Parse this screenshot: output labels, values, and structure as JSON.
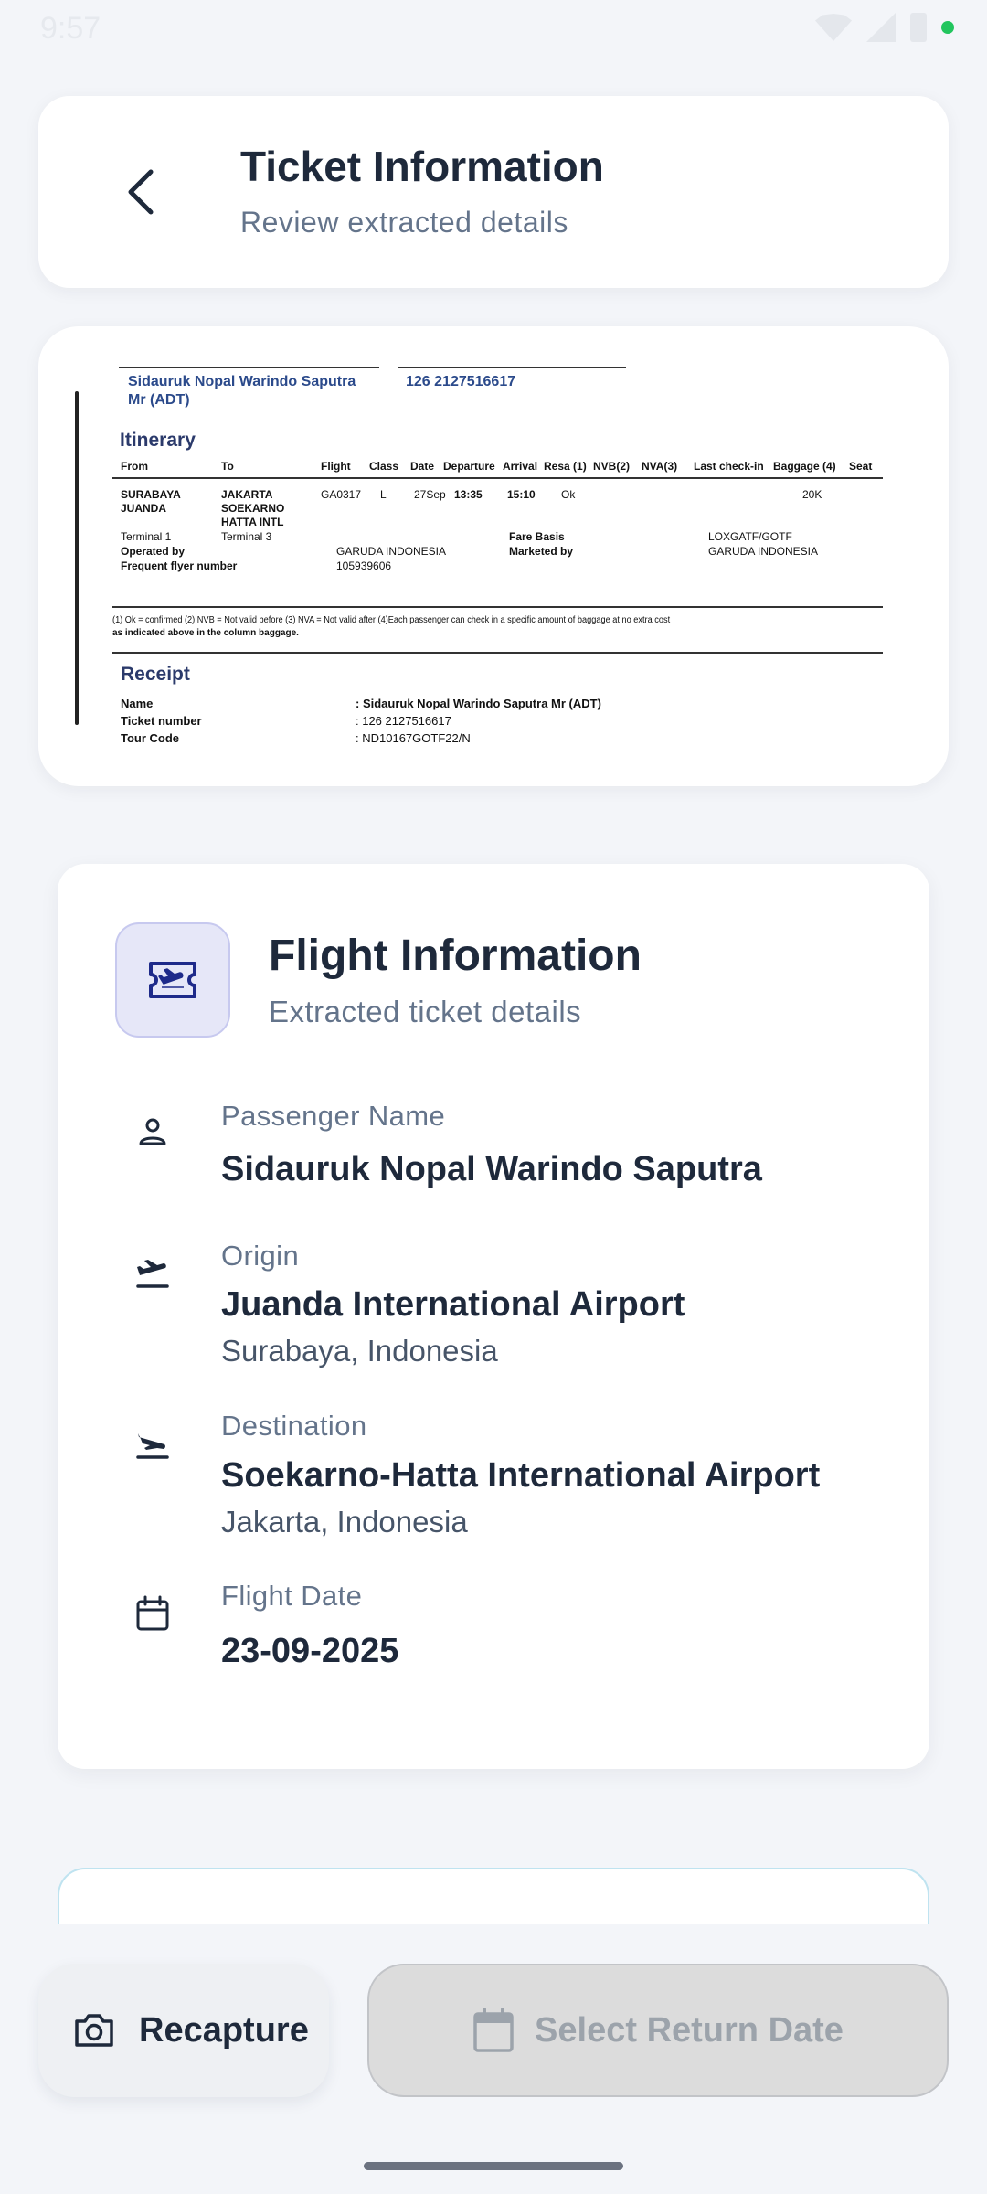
{
  "status_bar": {
    "time": "9:57"
  },
  "header": {
    "title": "Ticket Information",
    "subtitle": "Review extracted details"
  },
  "ticket_image": {
    "passenger_name_line1": "Sidauruk Nopal Warindo Saputra",
    "passenger_name_line2": "Mr (ADT)",
    "ticket_number_top": "126 2127516617",
    "itinerary_heading": "Itinerary",
    "columns": [
      "From",
      "To",
      "Flight",
      "Class",
      "Date",
      "Departure",
      "Arrival",
      "Resa (1)",
      "NVB(2)",
      "NVA(3)",
      "Last check-in",
      "Baggage (4)",
      "Seat"
    ],
    "from_1": "SURABAYA",
    "from_2": "JUANDA",
    "to_1": "JAKARTA",
    "to_2": "SOEKARNO",
    "to_3": "HATTA INTL",
    "flight": "GA0317",
    "class": "L",
    "date": "27Sep",
    "departure": "13:35",
    "arrival": "15:10",
    "resa": "Ok",
    "baggage": "20K",
    "terminal_from": "Terminal 1",
    "terminal_to": "Terminal 3",
    "fare_basis_label": "Fare Basis",
    "fare_basis": "LOXGATF/GOTF",
    "operated_by_label": "Operated by",
    "operated_by": "GARUDA INDONESIA",
    "marketed_by_label": "Marketed by",
    "marketed_by": "GARUDA INDONESIA",
    "ffn_label": "Frequent flyer number",
    "ffn": "105939606",
    "notes_line1": "(1) Ok = confirmed (2) NVB = Not valid before (3) NVA = Not valid after (4)Each passenger can check in a specific amount of baggage at no extra cost",
    "notes_line2": "as indicated above in the column baggage.",
    "receipt_heading": "Receipt",
    "name_label": "Name",
    "name_value": ": Sidauruk Nopal Warindo Saputra Mr (ADT)",
    "ticket_label": "Ticket number",
    "ticket_value": ": 126 2127516617",
    "tour_label": "Tour Code",
    "tour_value": ": ND10167GOTF22/N"
  },
  "flight_info": {
    "title": "Flight Information",
    "subtitle": "Extracted ticket details",
    "passenger": {
      "label": "Passenger Name",
      "value": "Sidauruk Nopal Warindo Saputra"
    },
    "origin": {
      "label": "Origin",
      "value": "Juanda International Airport",
      "sub": "Surabaya, Indonesia"
    },
    "destination": {
      "label": "Destination",
      "value": "Soekarno-Hatta International Airport",
      "sub": "Jakarta, Indonesia"
    },
    "date": {
      "label": "Flight Date",
      "value": "23-09-2025"
    }
  },
  "actions": {
    "recapture": "Recapture",
    "select_return": "Select Return Date"
  }
}
